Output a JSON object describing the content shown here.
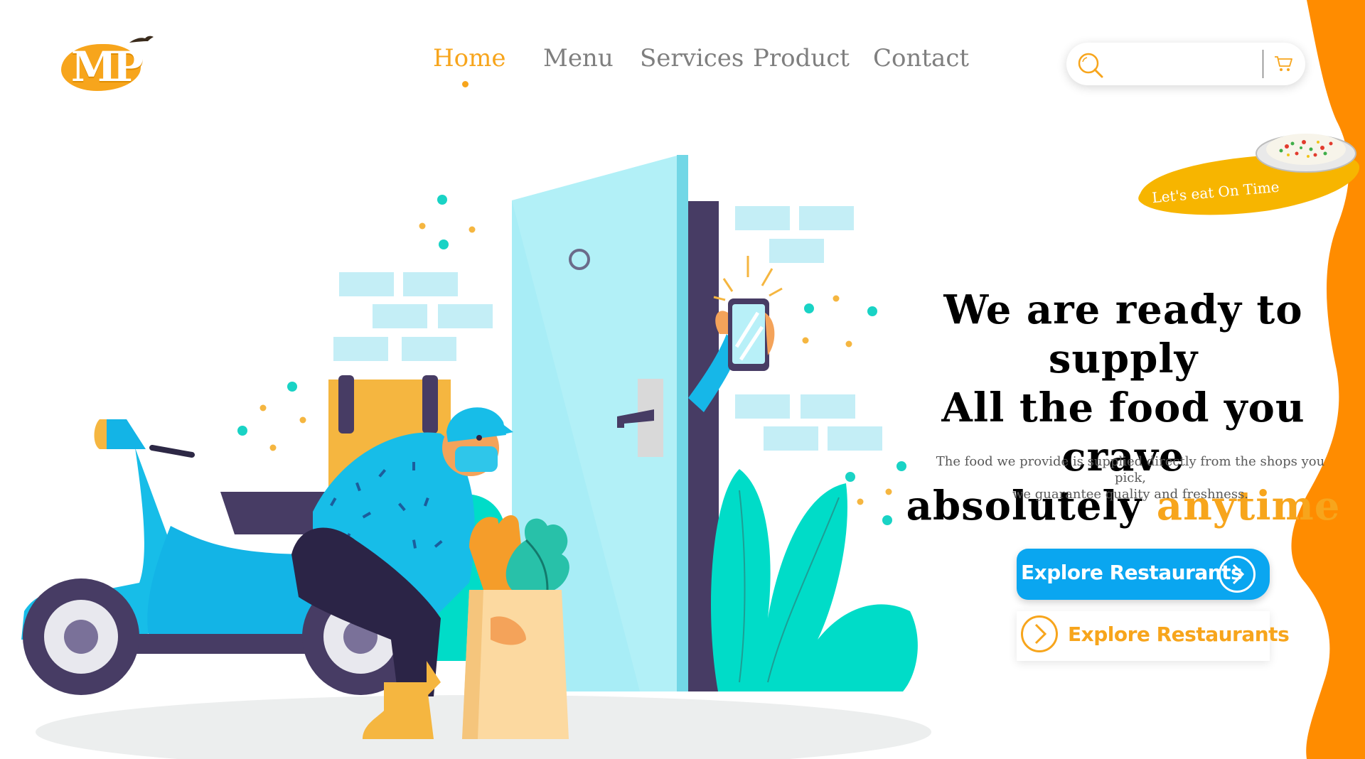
{
  "brand": {
    "logo_text": "MP",
    "logo_alt": "MP logo"
  },
  "nav": {
    "items": [
      {
        "label": "Home",
        "active": true
      },
      {
        "label": "Menu",
        "active": false
      },
      {
        "label": "Services",
        "active": false
      },
      {
        "label": "Product",
        "active": false
      },
      {
        "label": "Contact",
        "active": false
      }
    ]
  },
  "search": {
    "placeholder": "",
    "icon": "search-icon",
    "cart_icon": "cart-icon"
  },
  "badge": {
    "text": "Let's eat On Time"
  },
  "hero": {
    "line1": "We are ready to supply",
    "line2": "All the food you crave",
    "line3_prefix": "absolutely ",
    "line3_highlight": "anytime",
    "subtext_line1": "The food we provide is supplied directly from the shops you pick,",
    "subtext_line2": "we guarantee quality and freshness."
  },
  "buttons": {
    "primary_label": "Explore Restaurants",
    "secondary_label": "Explore Restaurants"
  },
  "colors": {
    "accent": "#f7a51c",
    "orange_wave": "#ff8c00",
    "primary_button": "#0aa6f0",
    "nav_text": "#7f7f7f",
    "headline": "#000000"
  }
}
